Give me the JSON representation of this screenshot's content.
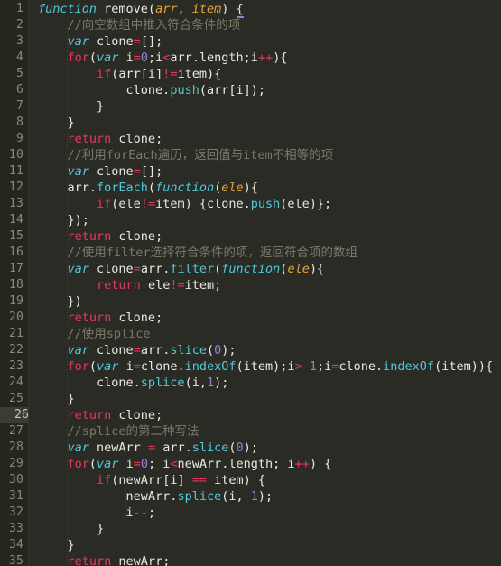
{
  "editor": {
    "name": "code-editor",
    "language": "JavaScript",
    "theme": "monokai-dark",
    "total_visible_lines": 35,
    "active_line": 26,
    "colors": {
      "background": "#2b2b26",
      "gutter_background": "#26261f",
      "line_number": "#8a8a78",
      "active_line_highlight": "#3c3c31",
      "keyword": "#e8365f",
      "declaration": "#4ec9d9",
      "parameter": "#e6a23c",
      "method": "#4ec9d9",
      "number": "#9a7fd4",
      "operator": "#e8365f",
      "comment": "#7a7a68",
      "plain_text": "#e8e8e0",
      "bracket_match_underline": "#9a7fd4"
    }
  },
  "gutter": {
    "line_numbers": [
      "1",
      "2",
      "3",
      "4",
      "5",
      "6",
      "7",
      "8",
      "9",
      "10",
      "11",
      "12",
      "13",
      "14",
      "15",
      "16",
      "17",
      "18",
      "19",
      "20",
      "21",
      "22",
      "23",
      "24",
      "25",
      "26",
      "27",
      "28",
      "29",
      "30",
      "31",
      "32",
      "33",
      "34",
      "35"
    ]
  },
  "code": {
    "lines": [
      {
        "n": 1,
        "text": "function remove(arr, item) {",
        "tokens": [
          {
            "t": "function",
            "c": "decl"
          },
          {
            "t": " ",
            "c": "pun"
          },
          {
            "t": "remove",
            "c": "fn"
          },
          {
            "t": "(",
            "c": "pun"
          },
          {
            "t": "arr",
            "c": "param"
          },
          {
            "t": ", ",
            "c": "pun"
          },
          {
            "t": "item",
            "c": "param"
          },
          {
            "t": ") ",
            "c": "pun"
          },
          {
            "t": "{",
            "c": "brmatch"
          }
        ]
      },
      {
        "n": 2,
        "text": "    //向空数组中推入符合条件的项",
        "tokens": [
          {
            "t": "    ",
            "c": "pun"
          },
          {
            "t": "//向空数组中推入符合条件的项",
            "c": "cmt"
          }
        ]
      },
      {
        "n": 3,
        "text": "    var clone=[];",
        "tokens": [
          {
            "t": "    ",
            "c": "pun"
          },
          {
            "t": "var",
            "c": "decl"
          },
          {
            "t": " clone",
            "c": "pun"
          },
          {
            "t": "=",
            "c": "op"
          },
          {
            "t": "[];",
            "c": "pun"
          }
        ]
      },
      {
        "n": 4,
        "text": "    for(var i=0;i<arr.length;i++){",
        "tokens": [
          {
            "t": "    ",
            "c": "pun"
          },
          {
            "t": "for",
            "c": "kw"
          },
          {
            "t": "(",
            "c": "pun"
          },
          {
            "t": "var",
            "c": "decl"
          },
          {
            "t": " i",
            "c": "pun"
          },
          {
            "t": "=",
            "c": "op"
          },
          {
            "t": "0",
            "c": "num"
          },
          {
            "t": ";i",
            "c": "pun"
          },
          {
            "t": "<",
            "c": "op"
          },
          {
            "t": "arr.length;i",
            "c": "pun"
          },
          {
            "t": "++",
            "c": "op"
          },
          {
            "t": "){",
            "c": "pun"
          }
        ]
      },
      {
        "n": 5,
        "text": "        if(arr[i]!=item){",
        "tokens": [
          {
            "t": "        ",
            "c": "pun"
          },
          {
            "t": "if",
            "c": "kw"
          },
          {
            "t": "(arr[i]",
            "c": "pun"
          },
          {
            "t": "!=",
            "c": "op"
          },
          {
            "t": "item){",
            "c": "pun"
          }
        ]
      },
      {
        "n": 6,
        "text": "            clone.push(arr[i]);",
        "tokens": [
          {
            "t": "            clone.",
            "c": "pun"
          },
          {
            "t": "push",
            "c": "meth"
          },
          {
            "t": "(arr[i]);",
            "c": "pun"
          }
        ]
      },
      {
        "n": 7,
        "text": "        }",
        "tokens": [
          {
            "t": "        }",
            "c": "pun"
          }
        ]
      },
      {
        "n": 8,
        "text": "    }",
        "tokens": [
          {
            "t": "    }",
            "c": "pun"
          }
        ]
      },
      {
        "n": 9,
        "text": "    return clone;",
        "tokens": [
          {
            "t": "    ",
            "c": "pun"
          },
          {
            "t": "return",
            "c": "kw"
          },
          {
            "t": " clone;",
            "c": "pun"
          }
        ]
      },
      {
        "n": 10,
        "text": "    //利用forEach遍历，返回值与item不相等的项",
        "tokens": [
          {
            "t": "    ",
            "c": "pun"
          },
          {
            "t": "//利用forEach遍历，返回值与item不相等的项",
            "c": "cmt"
          }
        ]
      },
      {
        "n": 11,
        "text": "    var clone=[];",
        "tokens": [
          {
            "t": "    ",
            "c": "pun"
          },
          {
            "t": "var",
            "c": "decl"
          },
          {
            "t": " clone",
            "c": "pun"
          },
          {
            "t": "=",
            "c": "op"
          },
          {
            "t": "[];",
            "c": "pun"
          }
        ]
      },
      {
        "n": 12,
        "text": "    arr.forEach(function(ele){",
        "tokens": [
          {
            "t": "    arr.",
            "c": "pun"
          },
          {
            "t": "forEach",
            "c": "meth"
          },
          {
            "t": "(",
            "c": "pun"
          },
          {
            "t": "function",
            "c": "decl"
          },
          {
            "t": "(",
            "c": "pun"
          },
          {
            "t": "ele",
            "c": "param"
          },
          {
            "t": "){",
            "c": "pun"
          }
        ]
      },
      {
        "n": 13,
        "text": "        if(ele!=item) {clone.push(ele)};",
        "tokens": [
          {
            "t": "        ",
            "c": "pun"
          },
          {
            "t": "if",
            "c": "kw"
          },
          {
            "t": "(ele",
            "c": "pun"
          },
          {
            "t": "!=",
            "c": "op"
          },
          {
            "t": "item) {clone.",
            "c": "pun"
          },
          {
            "t": "push",
            "c": "meth"
          },
          {
            "t": "(ele)};",
            "c": "pun"
          }
        ]
      },
      {
        "n": 14,
        "text": "    });",
        "tokens": [
          {
            "t": "    });",
            "c": "pun"
          }
        ]
      },
      {
        "n": 15,
        "text": "    return clone;",
        "tokens": [
          {
            "t": "    ",
            "c": "pun"
          },
          {
            "t": "return",
            "c": "kw"
          },
          {
            "t": " clone;",
            "c": "pun"
          }
        ]
      },
      {
        "n": 16,
        "text": "    //使用filter选择符合条件的项，返回符合项的数组",
        "tokens": [
          {
            "t": "    ",
            "c": "pun"
          },
          {
            "t": "//使用filter选择符合条件的项，返回符合项的数组",
            "c": "cmt"
          }
        ]
      },
      {
        "n": 17,
        "text": "    var clone=arr.filter(function(ele){",
        "tokens": [
          {
            "t": "    ",
            "c": "pun"
          },
          {
            "t": "var",
            "c": "decl"
          },
          {
            "t": " clone",
            "c": "pun"
          },
          {
            "t": "=",
            "c": "op"
          },
          {
            "t": "arr.",
            "c": "pun"
          },
          {
            "t": "filter",
            "c": "meth"
          },
          {
            "t": "(",
            "c": "pun"
          },
          {
            "t": "function",
            "c": "decl"
          },
          {
            "t": "(",
            "c": "pun"
          },
          {
            "t": "ele",
            "c": "param"
          },
          {
            "t": "){",
            "c": "pun"
          }
        ]
      },
      {
        "n": 18,
        "text": "        return ele!=item;",
        "tokens": [
          {
            "t": "        ",
            "c": "pun"
          },
          {
            "t": "return",
            "c": "kw"
          },
          {
            "t": " ele",
            "c": "pun"
          },
          {
            "t": "!=",
            "c": "op"
          },
          {
            "t": "item;",
            "c": "pun"
          }
        ]
      },
      {
        "n": 19,
        "text": "    })",
        "tokens": [
          {
            "t": "    })",
            "c": "pun"
          }
        ]
      },
      {
        "n": 20,
        "text": "    return clone;",
        "tokens": [
          {
            "t": "    ",
            "c": "pun"
          },
          {
            "t": "return",
            "c": "kw"
          },
          {
            "t": " clone;",
            "c": "pun"
          }
        ]
      },
      {
        "n": 21,
        "text": "    //使用splice",
        "tokens": [
          {
            "t": "    ",
            "c": "pun"
          },
          {
            "t": "//使用splice",
            "c": "cmt"
          }
        ]
      },
      {
        "n": 22,
        "text": "    var clone=arr.slice(0);",
        "tokens": [
          {
            "t": "    ",
            "c": "pun"
          },
          {
            "t": "var",
            "c": "decl"
          },
          {
            "t": " clone",
            "c": "pun"
          },
          {
            "t": "=",
            "c": "op"
          },
          {
            "t": "arr.",
            "c": "pun"
          },
          {
            "t": "slice",
            "c": "meth"
          },
          {
            "t": "(",
            "c": "pun"
          },
          {
            "t": "0",
            "c": "num"
          },
          {
            "t": ");",
            "c": "pun"
          }
        ]
      },
      {
        "n": 23,
        "text": "    for(var i=clone.indexOf(item);i>-1;i=clone.indexOf(item)){",
        "tokens": [
          {
            "t": "    ",
            "c": "pun"
          },
          {
            "t": "for",
            "c": "kw"
          },
          {
            "t": "(",
            "c": "pun"
          },
          {
            "t": "var",
            "c": "decl"
          },
          {
            "t": " i",
            "c": "pun"
          },
          {
            "t": "=",
            "c": "op"
          },
          {
            "t": "clone.",
            "c": "pun"
          },
          {
            "t": "indexOf",
            "c": "meth"
          },
          {
            "t": "(item);i",
            "c": "pun"
          },
          {
            "t": ">-",
            "c": "op"
          },
          {
            "t": "1",
            "c": "num"
          },
          {
            "t": ";i",
            "c": "pun"
          },
          {
            "t": "=",
            "c": "op"
          },
          {
            "t": "clone.",
            "c": "pun"
          },
          {
            "t": "indexOf",
            "c": "meth"
          },
          {
            "t": "(item)){",
            "c": "pun"
          }
        ]
      },
      {
        "n": 24,
        "text": "        clone.splice(i,1);",
        "tokens": [
          {
            "t": "        clone.",
            "c": "pun"
          },
          {
            "t": "splice",
            "c": "meth"
          },
          {
            "t": "(i,",
            "c": "pun"
          },
          {
            "t": "1",
            "c": "num"
          },
          {
            "t": ");",
            "c": "pun"
          }
        ]
      },
      {
        "n": 25,
        "text": "    }",
        "tokens": [
          {
            "t": "    }",
            "c": "pun"
          }
        ]
      },
      {
        "n": 26,
        "text": "    return clone;",
        "tokens": [
          {
            "t": "    ",
            "c": "pun"
          },
          {
            "t": "return",
            "c": "kw"
          },
          {
            "t": " clone;",
            "c": "pun"
          }
        ]
      },
      {
        "n": 27,
        "text": "    //splice的第二种写法",
        "tokens": [
          {
            "t": "    ",
            "c": "pun"
          },
          {
            "t": "//splice的第二种写法",
            "c": "cmt"
          }
        ]
      },
      {
        "n": 28,
        "text": "    var newArr = arr.slice(0);",
        "tokens": [
          {
            "t": "    ",
            "c": "pun"
          },
          {
            "t": "var",
            "c": "decl"
          },
          {
            "t": " newArr ",
            "c": "pun"
          },
          {
            "t": "=",
            "c": "op"
          },
          {
            "t": " arr.",
            "c": "pun"
          },
          {
            "t": "slice",
            "c": "meth"
          },
          {
            "t": "(",
            "c": "pun"
          },
          {
            "t": "0",
            "c": "num"
          },
          {
            "t": ");",
            "c": "pun"
          }
        ]
      },
      {
        "n": 29,
        "text": "    for(var i=0; i<newArr.length; i++) {",
        "tokens": [
          {
            "t": "    ",
            "c": "pun"
          },
          {
            "t": "for",
            "c": "kw"
          },
          {
            "t": "(",
            "c": "pun"
          },
          {
            "t": "var",
            "c": "decl"
          },
          {
            "t": " i",
            "c": "pun"
          },
          {
            "t": "=",
            "c": "op"
          },
          {
            "t": "0",
            "c": "num"
          },
          {
            "t": "; i",
            "c": "pun"
          },
          {
            "t": "<",
            "c": "op"
          },
          {
            "t": "newArr.length; i",
            "c": "pun"
          },
          {
            "t": "++",
            "c": "op"
          },
          {
            "t": ") {",
            "c": "pun"
          }
        ]
      },
      {
        "n": 30,
        "text": "        if(newArr[i] == item) {",
        "tokens": [
          {
            "t": "        ",
            "c": "pun"
          },
          {
            "t": "if",
            "c": "kw"
          },
          {
            "t": "(newArr[i] ",
            "c": "pun"
          },
          {
            "t": "==",
            "c": "op"
          },
          {
            "t": " item) {",
            "c": "pun"
          }
        ]
      },
      {
        "n": 31,
        "text": "            newArr.splice(i, 1);",
        "tokens": [
          {
            "t": "            newArr.",
            "c": "pun"
          },
          {
            "t": "splice",
            "c": "meth"
          },
          {
            "t": "(i, ",
            "c": "pun"
          },
          {
            "t": "1",
            "c": "num"
          },
          {
            "t": ");",
            "c": "pun"
          }
        ]
      },
      {
        "n": 32,
        "text": "            i--;",
        "tokens": [
          {
            "t": "            i",
            "c": "pun"
          },
          {
            "t": "--",
            "c": "op"
          },
          {
            "t": ";",
            "c": "pun"
          }
        ]
      },
      {
        "n": 33,
        "text": "        }",
        "tokens": [
          {
            "t": "        }",
            "c": "pun"
          }
        ]
      },
      {
        "n": 34,
        "text": "    }",
        "tokens": [
          {
            "t": "    }",
            "c": "pun"
          }
        ]
      },
      {
        "n": 35,
        "text": "    return newArr;",
        "tokens": [
          {
            "t": "    ",
            "c": "pun"
          },
          {
            "t": "return",
            "c": "kw"
          },
          {
            "t": " newArr;",
            "c": "pun"
          }
        ]
      }
    ],
    "indent_guides": [
      {
        "col": 1,
        "from_line": 2,
        "to_line": 35
      },
      {
        "col": 2,
        "from_line": 5,
        "to_line": 7
      },
      {
        "col": 2,
        "from_line": 13,
        "to_line": 13
      },
      {
        "col": 2,
        "from_line": 18,
        "to_line": 18
      },
      {
        "col": 2,
        "from_line": 24,
        "to_line": 24
      },
      {
        "col": 2,
        "from_line": 30,
        "to_line": 33
      },
      {
        "col": 3,
        "from_line": 6,
        "to_line": 6
      },
      {
        "col": 3,
        "from_line": 31,
        "to_line": 32
      }
    ]
  }
}
